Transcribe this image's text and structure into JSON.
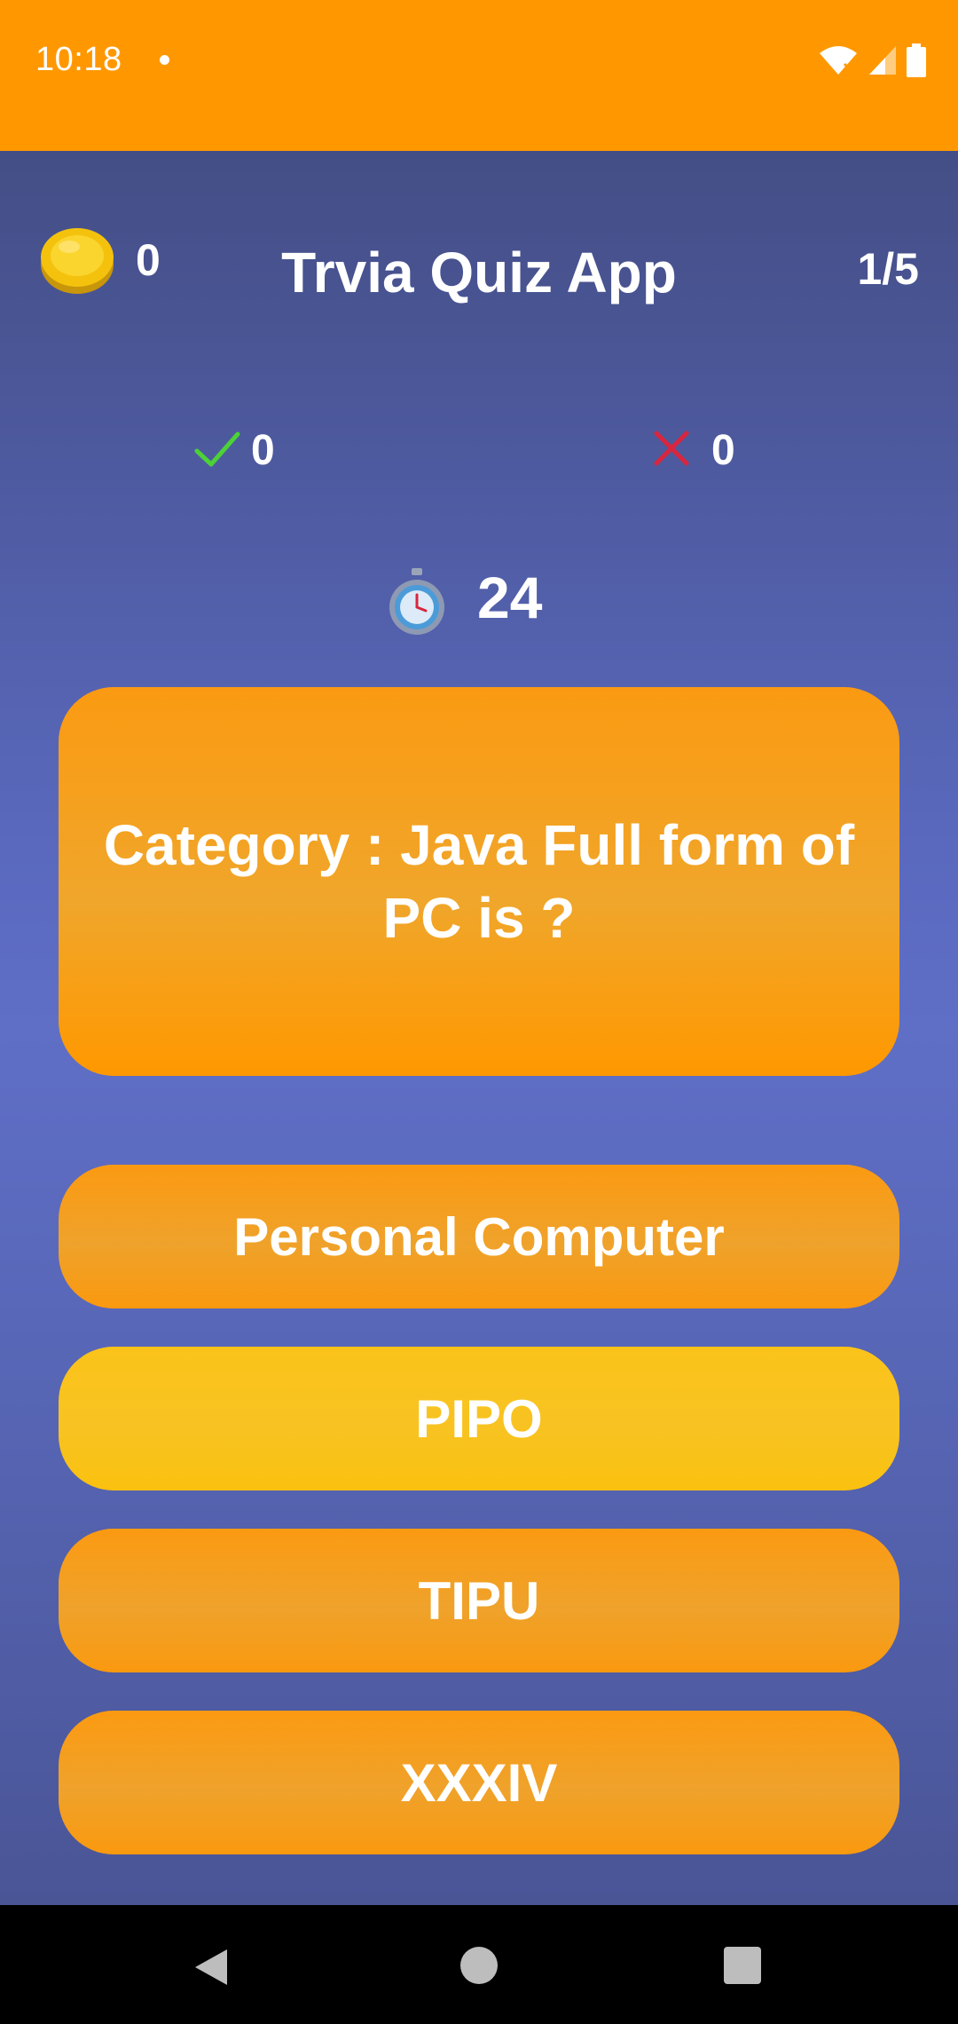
{
  "status_bar": {
    "time": "10:18",
    "icons": [
      "notification-dot-icon",
      "wifi-icon",
      "signal-icon",
      "battery-icon"
    ]
  },
  "header": {
    "coins": "0",
    "title": "Trvia Quiz App",
    "progress": "1/5"
  },
  "score": {
    "correct": "0",
    "wrong": "0"
  },
  "timer": {
    "seconds": "24"
  },
  "question": {
    "text": "Category : Java Full form of PC is ?"
  },
  "options": [
    {
      "label": "Personal Computer",
      "color": "#F7A020"
    },
    {
      "label": "PIPO",
      "color": "#FAC11A"
    },
    {
      "label": "TIPU",
      "color": "#F7A020"
    },
    {
      "label": "XXXIV",
      "color": "#F7A020"
    }
  ],
  "colors": {
    "status_bar": "#FF9800",
    "background_top": "#444E86",
    "background_mid": "#5F6FC6",
    "card": "#FB9A12",
    "selected_option": "#FAC11A",
    "correct": "#4CD137",
    "wrong": "#D7263D"
  }
}
